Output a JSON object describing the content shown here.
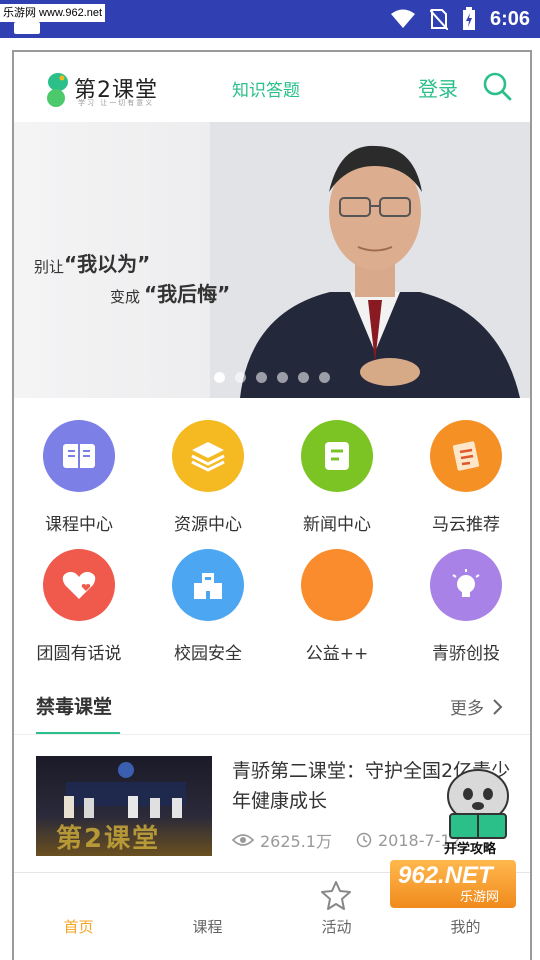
{
  "status_bar": {
    "watermark": "乐游网 www.962.net",
    "time": "6:06"
  },
  "header": {
    "logo_text": "第2课堂",
    "logo_sub": "学习 让一切有意义",
    "mid_link": "知识答题",
    "login": "登录",
    "search_icon": "search-icon"
  },
  "banner": {
    "line1_prefix": "别让",
    "line1_quote": "“我以为”",
    "line2_prefix": "变成",
    "line2_quote": "“我后悔”",
    "dot_count": 6,
    "active_dot": 0
  },
  "grid": [
    {
      "label": "课程中心",
      "color": "#7b7fe6",
      "icon": "book-icon"
    },
    {
      "label": "资源中心",
      "color": "#f5b921",
      "icon": "layers-icon"
    },
    {
      "label": "新闻中心",
      "color": "#7cc324",
      "icon": "news-icon"
    },
    {
      "label": "马云推荐",
      "color": "#f59024",
      "icon": "recommend-icon"
    },
    {
      "label": "团圆有话说",
      "color": "#ef5a4c",
      "icon": "heart-icon"
    },
    {
      "label": "校园安全",
      "color": "#4da6f2",
      "icon": "building-icon"
    },
    {
      "label": "公益++",
      "color": "#fb8c2e",
      "icon": "charity-icon"
    },
    {
      "label": "青骄创投",
      "color": "#a882e6",
      "icon": "bulb-icon"
    }
  ],
  "section": {
    "title": "禁毒课堂",
    "more": "更多"
  },
  "news": {
    "title": "青骄第二课堂：守护全国2亿青少年健康成长",
    "views": "2625.1万",
    "date": "2018-7-12",
    "thumb_text": "第2课堂"
  },
  "bottom_nav": [
    {
      "label": "首页",
      "active": true
    },
    {
      "label": "课程",
      "active": false
    },
    {
      "label": "活动",
      "active": false
    },
    {
      "label": "我的",
      "active": false
    }
  ],
  "watermarks": {
    "tiger_text": "开学攻略",
    "site_num": "962.NET",
    "site_name": "乐游网"
  }
}
